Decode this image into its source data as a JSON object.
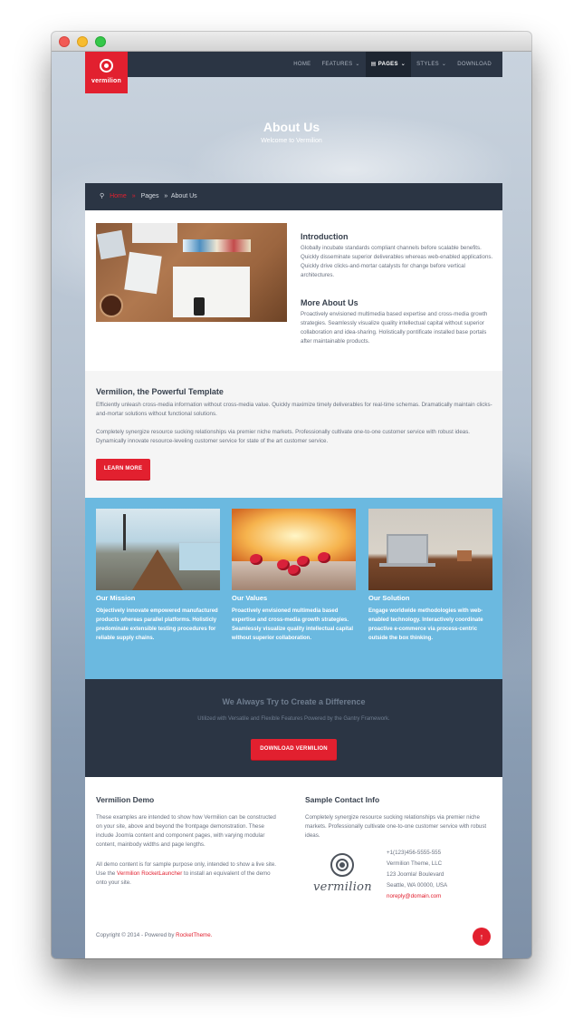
{
  "header": {
    "logo_text": "vermilion",
    "nav": [
      {
        "label": "Home",
        "dropdown": false
      },
      {
        "label": "Features",
        "dropdown": true
      },
      {
        "label": "Pages",
        "dropdown": true
      },
      {
        "label": "Styles",
        "dropdown": true
      },
      {
        "label": "Download",
        "dropdown": false
      }
    ],
    "active_nav": "Pages"
  },
  "hero": {
    "title": "About Us",
    "subtitle": "Welcome to Vermilion"
  },
  "breadcrumb": {
    "items": [
      "Home",
      "Pages",
      "About Us"
    ]
  },
  "intro": {
    "heading1": "Introduction",
    "text1": "Globally incubate standards compliant channels before scalable benefits. Quickly disseminate superior deliverables whereas web-enabled applications. Quickly drive clicks-and-mortar catalysts for change before vertical architectures.",
    "heading2": "More About Us",
    "text2": "Proactively envisioned multimedia based expertise and cross-media growth strategies. Seamlessly visualize quality intellectual capital without superior collaboration and idea-sharing. Holistically pontificate installed base portals after maintainable products."
  },
  "powerful": {
    "heading": "Vermilion, the Powerful Template",
    "text1": "Efficiently unleash cross-media information without cross-media value. Quickly maximize timely deliverables for real-time schemas. Dramatically maintain clicks-and-mortar solutions without functional solutions.",
    "text2": "Completely synergize resource sucking relationships via premier niche markets. Professionally cultivate one-to-one customer service with robust ideas. Dynamically innovate resource-leveling customer service for state of the art customer service.",
    "button": "Learn More"
  },
  "features": [
    {
      "title": "Our Mission",
      "text": "Objectively innovate empowered manufactured products whereas parallel platforms. Holisticly predominate extensible testing procedures for reliable supply chains."
    },
    {
      "title": "Our Values",
      "text": "Proactively envisioned multimedia based expertise and cross-media growth strategies. Seamlessly visualize quality intellectual capital without superior collaboration."
    },
    {
      "title": "Our Solution",
      "text": "Engage worldwide methodologies with web-enabled technology. Interactively coordinate proactive e-commerce via process-centric outside the box thinking."
    }
  ],
  "cta": {
    "heading": "We Always Try to Create a Difference",
    "sub": "Utilized with Versatile and Flexible Features Powered by the Gantry Framework.",
    "button": "Download Vermilion"
  },
  "footer": {
    "demo_heading": "Vermilion Demo",
    "demo_text1": "These examples are intended to show how Vermilion can be constructed on your site, above and beyond the frontpage demonstration. These include Joomla content and component pages, with varying modular content, mainbody widths and page lengths.",
    "demo_text2_a": "All demo content is for sample purpose only, intended to show a live site. Use the ",
    "demo_link": "Vermilion RocketLauncher",
    "demo_text2_b": " to install an equivalent of the demo onto your site.",
    "contact_heading": "Sample Contact Info",
    "contact_text": "Completely synergize resource sucking relationships via premier niche markets. Professionally cultivate one-to-one customer service with robust ideas.",
    "brand_text": "vermilion",
    "phone": "+1(123)456-5555-555",
    "company": "Vermilion Theme, LLC",
    "street": "123 Joomla! Boulevard",
    "city": "Seattle, WA 00000, USA",
    "email": "noreply@domain.com",
    "copyright": "Copyright © 2014 - Powered by ",
    "copyright_link": "RocketTheme."
  },
  "colors": {
    "accent": "#e2202f",
    "dark": "#2b3544",
    "blue": "#6bb9e0"
  }
}
